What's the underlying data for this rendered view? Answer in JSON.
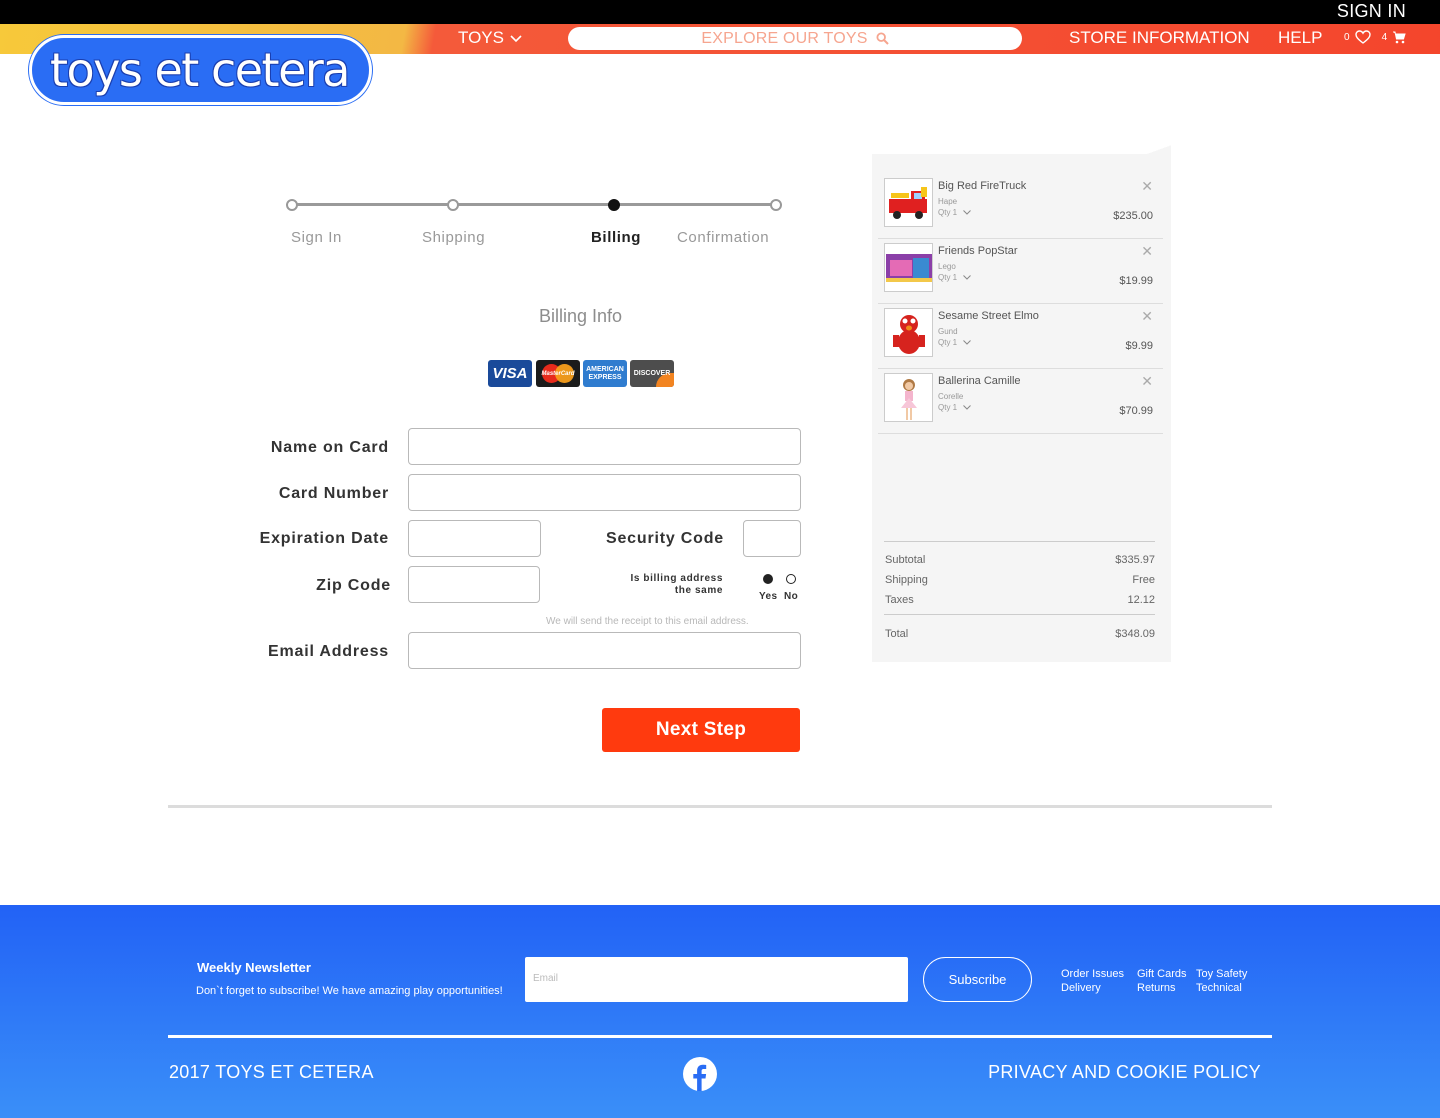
{
  "header": {
    "sign_in": "SIGN IN",
    "toys": "TOYS",
    "search_placeholder": "EXPLORE OUR TOYS",
    "store_info": "STORE INFORMATION",
    "help": "HELP",
    "wishlist_count": "0",
    "cart_count": "4",
    "logo_text": "toys et cetera"
  },
  "progress": {
    "steps": [
      "Sign In",
      "Shipping",
      "Billing",
      "Confirmation"
    ],
    "active_index": 2
  },
  "billing": {
    "title": "Billing Info",
    "card_brands": [
      "VISA",
      "MasterCard",
      "AMERICAN EXPRESS",
      "DISCOVER"
    ],
    "labels": {
      "name_on_card": "Name on Card",
      "card_number": "Card Number",
      "expiration_date": "Expiration Date",
      "security_code": "Security Code",
      "zip_code": "Zip Code",
      "email_address": "Email Address"
    },
    "billing_same_line1": "Is billing address",
    "billing_same_line2": "the same",
    "yes": "Yes",
    "no": "No",
    "billing_same_selected": "Yes",
    "receipt_note": "We will send the receipt to this email address.",
    "next_step": "Next Step"
  },
  "cart": {
    "items": [
      {
        "name": "Big Red FireTruck",
        "brand": "Hape",
        "qty": "Qty 1",
        "price": "$235.00"
      },
      {
        "name": "Friends PopStar",
        "brand": "Lego",
        "qty": "Qty 1",
        "price": "$19.99"
      },
      {
        "name": "Sesame Street Elmo",
        "brand": "Gund",
        "qty": "Qty 1",
        "price": "$9.99"
      },
      {
        "name": "Ballerina Camille",
        "brand": "Corelle",
        "qty": "Qty 1",
        "price": "$70.99"
      }
    ],
    "subtotal_label": "Subtotal",
    "subtotal": "$335.97",
    "shipping_label": "Shipping",
    "shipping": "Free",
    "taxes_label": "Taxes",
    "taxes": "12.12",
    "total_label": "Total",
    "total": "$348.09"
  },
  "footer": {
    "newsletter_title": "Weekly Newsletter",
    "newsletter_sub": "Don`t forget to subscribe! We have amazing play opportunities!",
    "email_placeholder": "Email",
    "subscribe": "Subscribe",
    "links": [
      "Order Issues",
      "Delivery",
      "Gift Cards",
      "Returns",
      "Toy Safety",
      "Technical"
    ],
    "copyright": "2017 TOYS ET CETERA",
    "privacy": "PRIVACY AND COOKIE POLICY"
  },
  "colors": {
    "accent": "#ff3a0e",
    "nav_red": "#f4452c",
    "nav_yellow": "#f7c93a",
    "brand_blue": "#2a6df4"
  }
}
